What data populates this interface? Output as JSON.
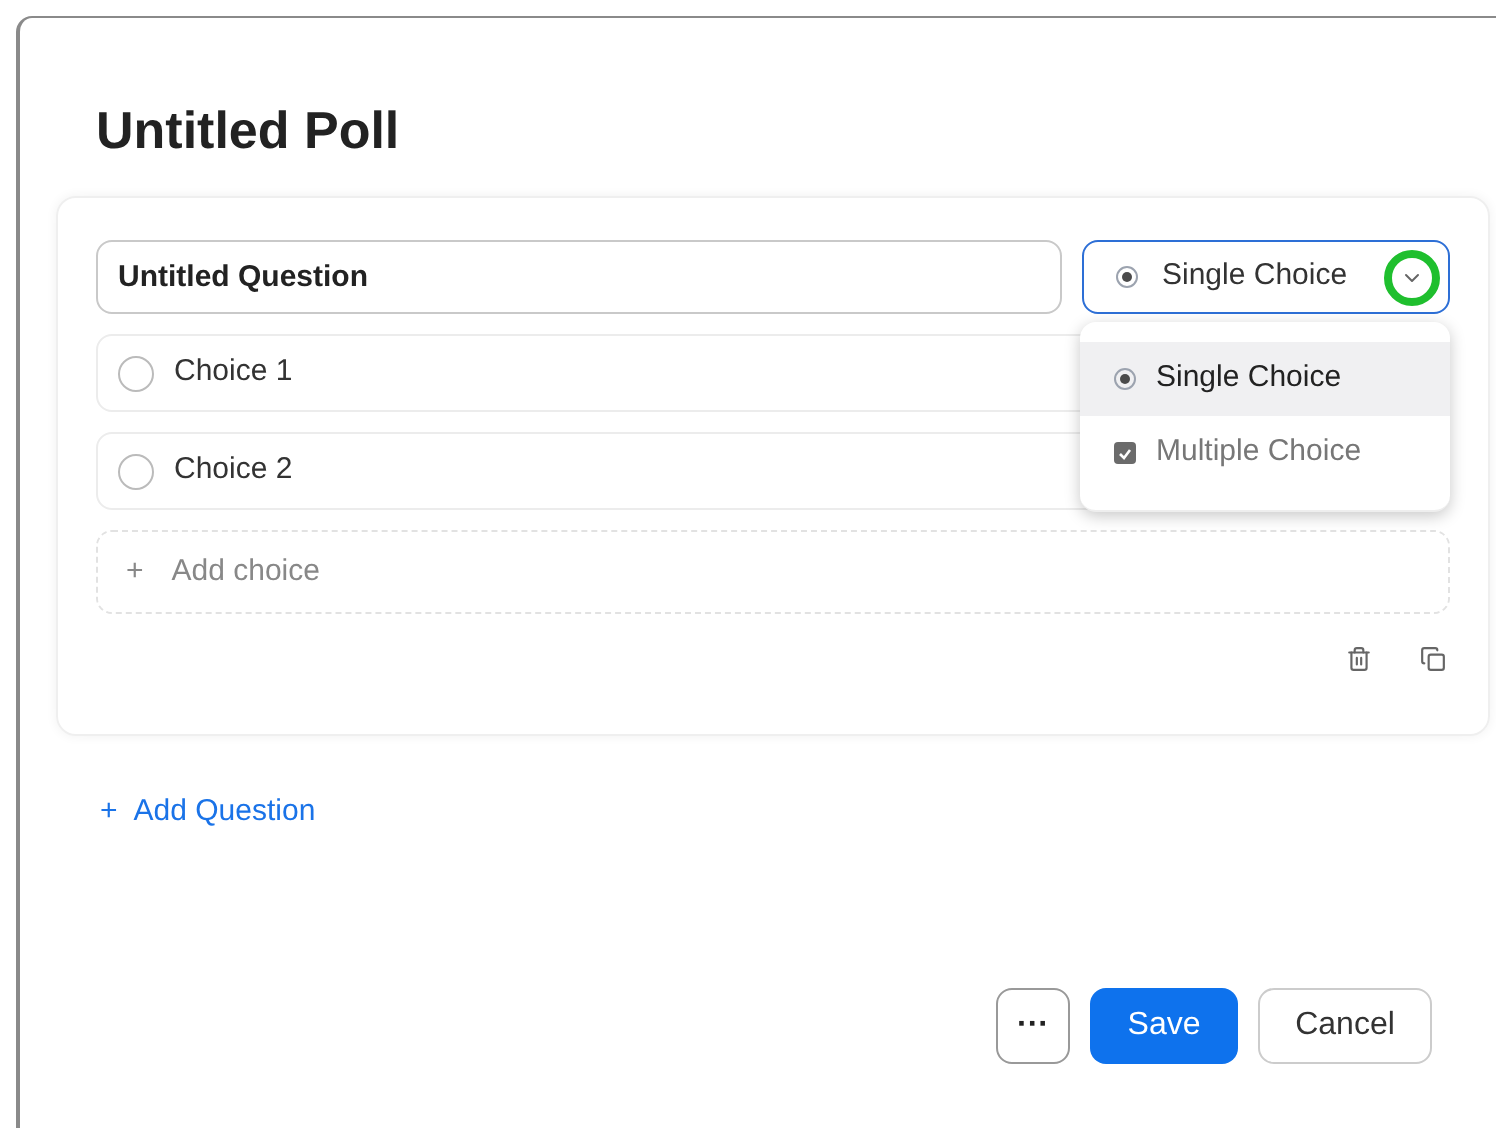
{
  "title": "Untitled Poll",
  "question": {
    "value": "Untitled Question",
    "type_select": {
      "label": "Single Choice",
      "open": true,
      "highlighted": true
    },
    "type_options": [
      {
        "label": "Single Choice",
        "kind": "radio",
        "selected": true
      },
      {
        "label": "Multiple Choice",
        "kind": "checkbox",
        "selected": false
      }
    ],
    "choices": [
      {
        "label": "Choice 1"
      },
      {
        "label": "Choice 2"
      }
    ],
    "add_choice": {
      "icon": "+",
      "label": "Add choice"
    }
  },
  "add_question": {
    "icon": "+",
    "label": "Add Question"
  },
  "buttons": [
    {
      "kind": "more",
      "label": "···"
    },
    {
      "kind": "primary",
      "label": "Save"
    },
    {
      "kind": "secondary",
      "label": "Cancel"
    }
  ]
}
